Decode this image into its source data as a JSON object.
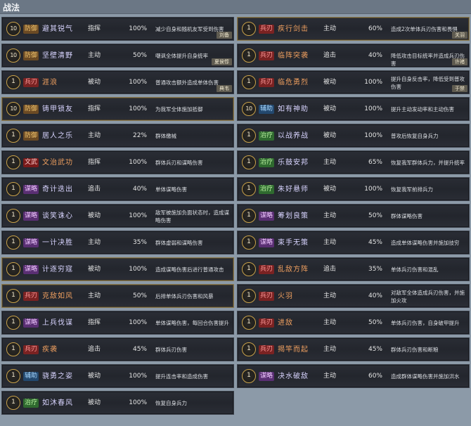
{
  "header": {
    "title": "战法"
  },
  "left": [
    {
      "lvl": "10",
      "tag": "防御",
      "tagType": "defense",
      "name": "避其锐气",
      "type": "指挥",
      "rate": "100%",
      "desc": "减少自身和随机友军受到伤害",
      "hero": "刘备",
      "hl": false
    },
    {
      "lvl": "10",
      "tag": "防御",
      "tagType": "defense",
      "name": "坚壁清野",
      "type": "主动",
      "rate": "50%",
      "desc": "嘲讽全体提升自身统率",
      "hero": "夏侯惇",
      "hl": false
    },
    {
      "lvl": "1",
      "tag": "兵刃",
      "tagType": "attack",
      "name": "涯浪",
      "type": "被动",
      "rate": "100%",
      "desc": "普通攻击额外造成单体伤害",
      "hero": "典韦",
      "hl": false
    },
    {
      "lvl": "10",
      "tag": "防御",
      "tagType": "defense",
      "name": "铸甲锁友",
      "type": "指挥",
      "rate": "100%",
      "desc": "为我军全体施加抵御",
      "hero": "",
      "hl": true
    },
    {
      "lvl": "1",
      "tag": "防御",
      "tagType": "defense",
      "name": "居人之乐",
      "type": "主动",
      "rate": "22%",
      "desc": "群体缴械",
      "hero": "",
      "hl": false
    },
    {
      "lvl": "1",
      "tag": "文武",
      "tagType": "command",
      "name": "文治武功",
      "type": "指挥",
      "rate": "100%",
      "desc": "群体兵刃和谋略伤害",
      "hero": "",
      "hl": false
    },
    {
      "lvl": "1",
      "tag": "谋略",
      "tagType": "strategy",
      "name": "奇计迭出",
      "type": "追击",
      "rate": "40%",
      "desc": "单体谋略伤害",
      "hero": "",
      "hl": false
    },
    {
      "lvl": "1",
      "tag": "谋略",
      "tagType": "strategy",
      "name": "谈笑诛心",
      "type": "被动",
      "rate": "100%",
      "desc": "敌军被施加负面状态时，造成谋略伤害",
      "hero": "",
      "hl": false
    },
    {
      "lvl": "1",
      "tag": "谋略",
      "tagType": "strategy",
      "name": "一计决胜",
      "type": "主动",
      "rate": "35%",
      "desc": "群体虚弱和谋略伤害",
      "hero": "",
      "hl": false
    },
    {
      "lvl": "1",
      "tag": "谋略",
      "tagType": "strategy",
      "name": "计逐穷寇",
      "type": "被动",
      "rate": "100%",
      "desc": "造成谋略伤害后进行普通攻击",
      "hero": "",
      "hl": true
    },
    {
      "lvl": "1",
      "tag": "兵刃",
      "tagType": "attack",
      "name": "克敌如风",
      "type": "主动",
      "rate": "50%",
      "desc": "后排单体兵刃伤害和风暴",
      "hero": "",
      "hl": true
    },
    {
      "lvl": "1",
      "tag": "谋略",
      "tagType": "strategy",
      "name": "上兵伐谋",
      "type": "指挥",
      "rate": "100%",
      "desc": "单体谋略伤害，每回合伤害提升",
      "hero": "",
      "hl": false
    },
    {
      "lvl": "1",
      "tag": "兵刃",
      "tagType": "attack",
      "name": "疾袭",
      "type": "追击",
      "rate": "45%",
      "desc": "群体兵刃伤害",
      "hero": "",
      "hl": false
    },
    {
      "lvl": "1",
      "tag": "辅助",
      "tagType": "support",
      "name": "骁勇之姿",
      "type": "被动",
      "rate": "100%",
      "desc": "提升连击率和造成伤害",
      "hero": "",
      "hl": false
    },
    {
      "lvl": "1",
      "tag": "治疗",
      "tagType": "heal",
      "name": "如沐春风",
      "type": "被动",
      "rate": "100%",
      "desc": "恢复自身兵力",
      "hero": "",
      "hl": false
    }
  ],
  "right": [
    {
      "lvl": "1",
      "tag": "兵刃",
      "tagType": "attack",
      "name": "疾行剑击",
      "type": "主动",
      "rate": "60%",
      "desc": "造成2次单体兵刃伤害和畏惧",
      "hero": "关羽",
      "hl": true
    },
    {
      "lvl": "1",
      "tag": "兵刃",
      "tagType": "attack",
      "name": "临阵突袭",
      "type": "追击",
      "rate": "40%",
      "desc": "降低攻击目标统率并造成兵刃伤害",
      "hero": "许褚",
      "hl": false
    },
    {
      "lvl": "1",
      "tag": "兵刃",
      "tagType": "attack",
      "name": "临危勇烈",
      "type": "被动",
      "rate": "100%",
      "desc": "提升自身反击率，降低受到普攻伤害",
      "hero": "于禁",
      "hl": false
    },
    {
      "lvl": "10",
      "tag": "辅助",
      "tagType": "support",
      "name": "如有神助",
      "type": "被动",
      "rate": "100%",
      "desc": "提升主动发动率和主动伤害",
      "hero": "",
      "hl": false
    },
    {
      "lvl": "1",
      "tag": "治疗",
      "tagType": "heal",
      "name": "以战养战",
      "type": "被动",
      "rate": "100%",
      "desc": "普攻后恢复自身兵力",
      "hero": "",
      "hl": false
    },
    {
      "lvl": "1",
      "tag": "治疗",
      "tagType": "heal",
      "name": "乐鼓安邦",
      "type": "主动",
      "rate": "65%",
      "desc": "恢复我军群体兵力，并提升统率",
      "hero": "",
      "hl": false
    },
    {
      "lvl": "1",
      "tag": "治疗",
      "tagType": "heal",
      "name": "朱好悬师",
      "type": "被动",
      "rate": "100%",
      "desc": "恢复我军前排兵力",
      "hero": "",
      "hl": false
    },
    {
      "lvl": "1",
      "tag": "谋略",
      "tagType": "strategy",
      "name": "筹划良策",
      "type": "主动",
      "rate": "50%",
      "desc": "群体谋略伤害",
      "hero": "",
      "hl": false
    },
    {
      "lvl": "1",
      "tag": "谋略",
      "tagType": "strategy",
      "name": "束手无策",
      "type": "主动",
      "rate": "45%",
      "desc": "造成单体谋略伤害并施加技穷",
      "hero": "",
      "hl": false
    },
    {
      "lvl": "1",
      "tag": "兵刃",
      "tagType": "attack",
      "name": "乱敌方阵",
      "type": "追击",
      "rate": "35%",
      "desc": "单体兵刃伤害和混乱",
      "hero": "",
      "hl": false
    },
    {
      "lvl": "1",
      "tag": "兵刃",
      "tagType": "attack",
      "name": "火羽",
      "type": "主动",
      "rate": "40%",
      "desc": "对敌军全体造成兵刃伤害，并施加火攻",
      "hero": "",
      "hl": false
    },
    {
      "lvl": "1",
      "tag": "兵刃",
      "tagType": "attack",
      "name": "进敌",
      "type": "主动",
      "rate": "50%",
      "desc": "单体兵刃伤害，自身破甲提升",
      "hero": "",
      "hl": false
    },
    {
      "lvl": "1",
      "tag": "兵刃",
      "tagType": "attack",
      "name": "揭竿而起",
      "type": "主动",
      "rate": "45%",
      "desc": "群体兵刃伤害和断粮",
      "hero": "",
      "hl": false
    },
    {
      "lvl": "1",
      "tag": "谋略",
      "tagType": "strategy",
      "name": "决水破敌",
      "type": "主动",
      "rate": "60%",
      "desc": "造成群体谋略伤害并施加洪水",
      "hero": "",
      "hl": false
    }
  ]
}
